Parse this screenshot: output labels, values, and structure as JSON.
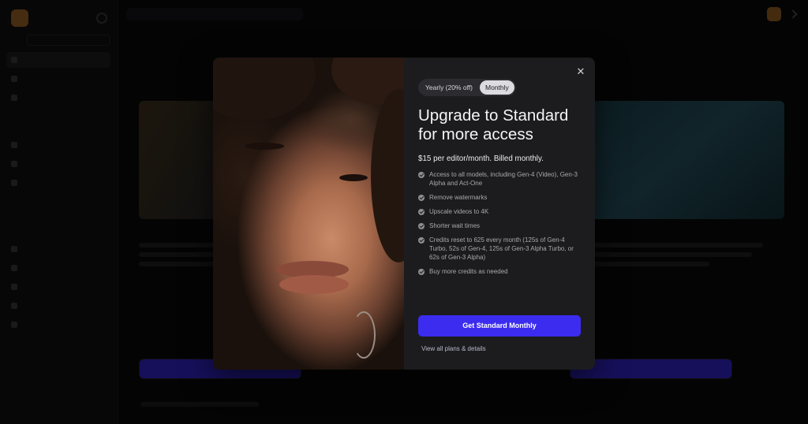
{
  "modal": {
    "billing_toggle": {
      "yearly_label": "Yearly (20% off)",
      "monthly_label": "Monthly",
      "selected": "Monthly"
    },
    "headline": "Upgrade to Standard for more access",
    "price_line": "$15 per editor/month. Billed monthly.",
    "features": [
      "Access to all models, including Gen-4 (Video), Gen-3 Alpha and Act-One",
      "Remove watermarks",
      "Upscale videos to 4K",
      "Shorter wait times",
      "Credits reset to 625 every month (125s of Gen-4 Turbo, 52s of Gen-4, 125s of Gen-3 Alpha Turbo, or 62s of Gen-3 Alpha)",
      "Buy more credits as needed"
    ],
    "cta_label": "Get Standard Monthly",
    "plans_link": "View all plans & details",
    "close_icon": "close-icon"
  },
  "colors": {
    "cta_background": "#3b2cf0",
    "modal_background": "#1c1c1f",
    "toggle_selected": "#dcdce0"
  }
}
